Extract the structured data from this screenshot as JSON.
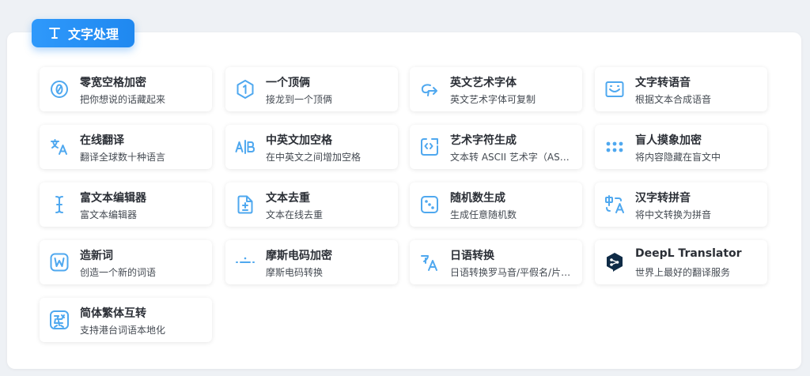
{
  "section": {
    "title": "文字处理",
    "icon": "text-type-icon",
    "accent": "#2f99fb"
  },
  "tools": [
    {
      "title": "零宽空格加密",
      "desc": "把你想说的话藏起来",
      "icon": "zero-circle-icon"
    },
    {
      "title": "一个顶俩",
      "desc": "接龙到一个顶俩",
      "icon": "hexagon-one-icon"
    },
    {
      "title": "英文艺术字体",
      "desc": "英文艺术字体可复制",
      "icon": "cursive-arrow-icon"
    },
    {
      "title": "文字转语音",
      "desc": "根据文本合成语音",
      "icon": "voice-box-icon"
    },
    {
      "title": "在线翻译",
      "desc": "翻译全球数十种语言",
      "icon": "translate-icon"
    },
    {
      "title": "中英文加空格",
      "desc": "在中英文之间增加空格",
      "icon": "ab-divider-icon"
    },
    {
      "title": "艺术字符生成",
      "desc": "文本转 ASCII 艺术字（ASCII Art）",
      "icon": "code-frame-icon"
    },
    {
      "title": "盲人摸象加密",
      "desc": "将内容隐藏在盲文中",
      "icon": "braille-dots-icon"
    },
    {
      "title": "富文本编辑器",
      "desc": "富文本编辑器",
      "icon": "text-cursor-icon"
    },
    {
      "title": "文本去重",
      "desc": "文本在线去重",
      "icon": "file-diff-icon"
    },
    {
      "title": "随机数生成",
      "desc": "生成任意随机数",
      "icon": "dice-icon"
    },
    {
      "title": "汉字转拼音",
      "desc": "将中文转换为拼音",
      "icon": "chinese-to-a-icon"
    },
    {
      "title": "造新词",
      "desc": "创造一个新的词语",
      "icon": "w-box-icon"
    },
    {
      "title": "摩斯电码加密",
      "desc": "摩斯电码转换",
      "icon": "morse-code-icon"
    },
    {
      "title": "日语转换",
      "desc": "日语转换罗马音/平假名/片假名",
      "icon": "japanese-a-icon"
    },
    {
      "title": "DeepL Translator",
      "desc": "世界上最好的翻译服务",
      "icon": "deepl-logo-icon"
    },
    {
      "title": "简体繁体互转",
      "desc": "支持港台词语本地化",
      "icon": "traditional-char-icon"
    }
  ]
}
